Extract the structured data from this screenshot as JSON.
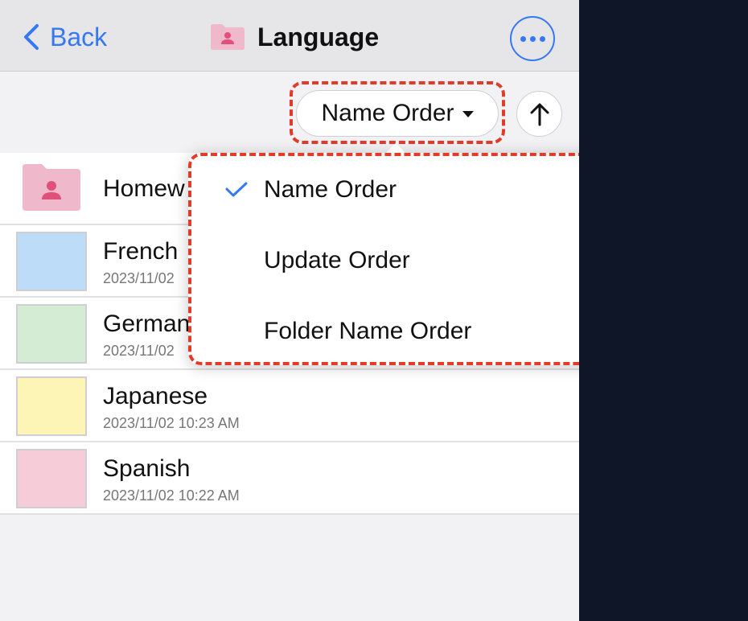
{
  "navbar": {
    "back_label": "Back",
    "title": "Language"
  },
  "sort": {
    "current": "Name Order",
    "direction": "ascending"
  },
  "list": {
    "items": [
      {
        "name": "Homew",
        "date": "",
        "type": "folder"
      },
      {
        "name": "French",
        "date": "2023/11/02",
        "color": "#bddcf7"
      },
      {
        "name": "German",
        "date": "2023/11/02",
        "color": "#d3ecd3"
      },
      {
        "name": "Japanese",
        "date": "2023/11/02 10:23 AM",
        "color": "#fdf5b5"
      },
      {
        "name": "Spanish",
        "date": "2023/11/02 10:22 AM",
        "color": "#f6ccd9"
      }
    ]
  },
  "menu": {
    "items": [
      {
        "label": "Name Order",
        "checked": true
      },
      {
        "label": "Update Order",
        "checked": false
      },
      {
        "label": "Folder Name Order",
        "checked": false
      }
    ]
  },
  "colors": {
    "accent": "#3478f6",
    "highlight": "#e23b2a",
    "folder_pink": "#f0b8cb",
    "folder_icon": "#e0507a"
  }
}
